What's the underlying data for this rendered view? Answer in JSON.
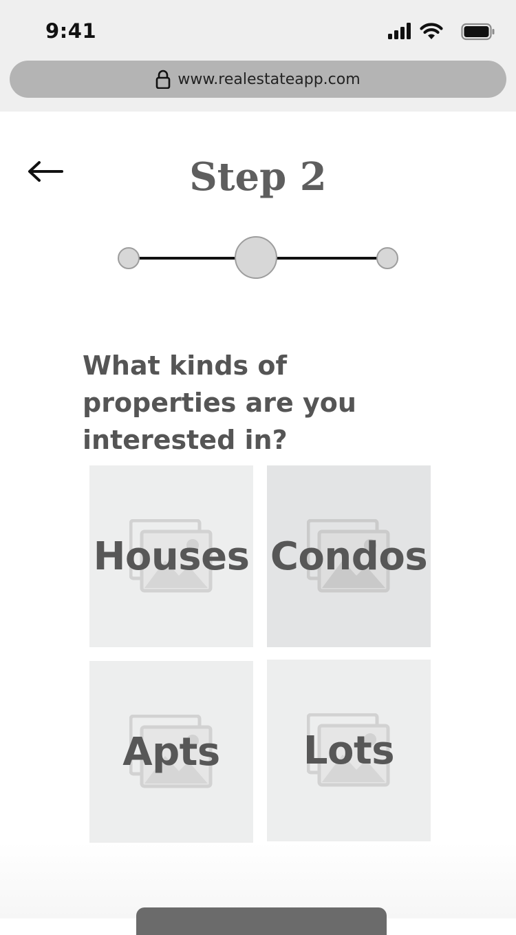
{
  "status_bar": {
    "time": "9:41"
  },
  "browser": {
    "url": "www.realestateapp.com"
  },
  "header": {
    "title": "Step 2"
  },
  "stepper": {
    "total_steps": 3,
    "current_step": 2
  },
  "question": {
    "text": "What kinds of properties are you interested in?"
  },
  "property_options": [
    {
      "label": "Houses",
      "selected": false
    },
    {
      "label": "Condos",
      "selected": true
    },
    {
      "label": "Apts",
      "selected": false
    },
    {
      "label": "Lots",
      "selected": false
    }
  ],
  "icons": {
    "back": "arrow-left-icon",
    "lock": "lock-icon",
    "signal": "cellular-signal-icon",
    "wifi": "wifi-icon",
    "battery": "battery-icon",
    "image_placeholder": "image-placeholder-icon"
  },
  "colors": {
    "chrome_background": "#efefef",
    "url_bar": "#b4b4b4",
    "title_text": "#5e5e5e",
    "body_text": "#555555",
    "tile_background": "#edeeee",
    "tile_selected_background": "#e3e4e5",
    "button": "#6b6b6b"
  }
}
